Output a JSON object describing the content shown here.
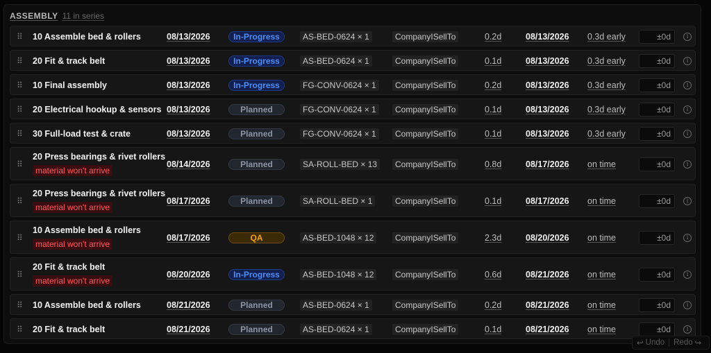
{
  "header": {
    "title": "ASSEMBLY",
    "count": "11 in series"
  },
  "rows": [
    {
      "op": "10 Assemble bed & rollers",
      "warning": "",
      "start": "08/13/2026",
      "status": "In-Progress",
      "status_kind": "inprogress",
      "part": "AS-BED-0624 × 1",
      "company": "CompanyISellTo",
      "duration": "0.2d",
      "end": "08/13/2026",
      "timing": "0.3d early",
      "offset": "±0d"
    },
    {
      "op": "20 Fit & track belt",
      "warning": "",
      "start": "08/13/2026",
      "status": "In-Progress",
      "status_kind": "inprogress",
      "part": "AS-BED-0624 × 1",
      "company": "CompanyISellTo",
      "duration": "0.1d",
      "end": "08/13/2026",
      "timing": "0.3d early",
      "offset": "±0d"
    },
    {
      "op": "10 Final assembly",
      "warning": "",
      "start": "08/13/2026",
      "status": "In-Progress",
      "status_kind": "inprogress",
      "part": "FG-CONV-0624 × 1",
      "company": "CompanyISellTo",
      "duration": "0.2d",
      "end": "08/13/2026",
      "timing": "0.3d early",
      "offset": "±0d"
    },
    {
      "op": "20 Electrical hookup & sensors",
      "warning": "",
      "start": "08/13/2026",
      "status": "Planned",
      "status_kind": "planned",
      "part": "FG-CONV-0624 × 1",
      "company": "CompanyISellTo",
      "duration": "0.1d",
      "end": "08/13/2026",
      "timing": "0.3d early",
      "offset": "±0d"
    },
    {
      "op": "30 Full-load test & crate",
      "warning": "",
      "start": "08/13/2026",
      "status": "Planned",
      "status_kind": "planned",
      "part": "FG-CONV-0624 × 1",
      "company": "CompanyISellTo",
      "duration": "0.1d",
      "end": "08/13/2026",
      "timing": "0.3d early",
      "offset": "±0d"
    },
    {
      "op": "20 Press bearings & rivet rollers",
      "warning": "material won't arrive",
      "start": "08/14/2026",
      "status": "Planned",
      "status_kind": "planned",
      "part": "SA-ROLL-BED × 13",
      "company": "CompanyISellTo",
      "duration": "0.8d",
      "end": "08/17/2026",
      "timing": "on time",
      "offset": "±0d"
    },
    {
      "op": "20 Press bearings & rivet rollers",
      "warning": "material won't arrive",
      "start": "08/17/2026",
      "status": "Planned",
      "status_kind": "planned",
      "part": "SA-ROLL-BED × 1",
      "company": "CompanyISellTo",
      "duration": "0.1d",
      "end": "08/17/2026",
      "timing": "on time",
      "offset": "±0d"
    },
    {
      "op": "10 Assemble bed & rollers",
      "warning": "material won't arrive",
      "start": "08/17/2026",
      "status": "QA",
      "status_kind": "qa",
      "part": "AS-BED-1048 × 12",
      "company": "CompanyISellTo",
      "duration": "2.3d",
      "end": "08/20/2026",
      "timing": "on time",
      "offset": "±0d"
    },
    {
      "op": "20 Fit & track belt",
      "warning": "material won't arrive",
      "start": "08/20/2026",
      "status": "In-Progress",
      "status_kind": "inprogress",
      "part": "AS-BED-1048 × 12",
      "company": "CompanyISellTo",
      "duration": "0.6d",
      "end": "08/21/2026",
      "timing": "on time",
      "offset": "±0d"
    },
    {
      "op": "10 Assemble bed & rollers",
      "warning": "",
      "start": "08/21/2026",
      "status": "Planned",
      "status_kind": "planned",
      "part": "AS-BED-0624 × 1",
      "company": "CompanyISellTo",
      "duration": "0.2d",
      "end": "08/21/2026",
      "timing": "on time",
      "offset": "±0d"
    },
    {
      "op": "20 Fit & track belt",
      "warning": "",
      "start": "08/21/2026",
      "status": "Planned",
      "status_kind": "planned",
      "part": "AS-BED-0624 × 1",
      "company": "CompanyISellTo",
      "duration": "0.1d",
      "end": "08/21/2026",
      "timing": "on time",
      "offset": "±0d"
    }
  ],
  "icons": {
    "grip": "drag-handle-icon",
    "info": "info-icon",
    "undo": "undo-icon",
    "redo": "redo-icon"
  },
  "footer": {
    "undo": "Undo",
    "redo": "Redo"
  },
  "colors": {
    "in_progress": "#4f8df5",
    "planned": "#8b95a5",
    "qa": "#f5a20b",
    "warning": "#ff5a5f"
  }
}
